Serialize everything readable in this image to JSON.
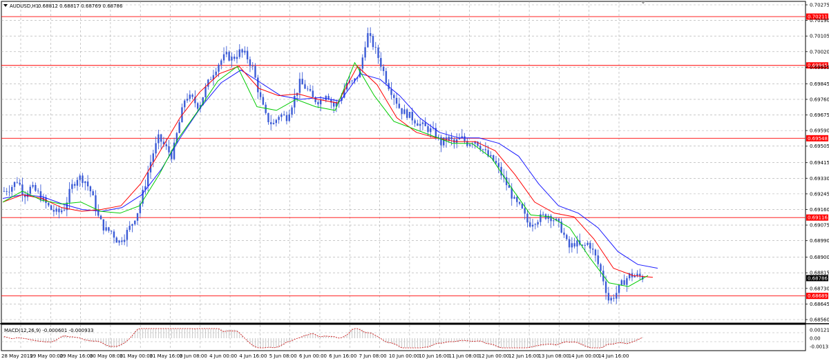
{
  "header": {
    "symbol": "AUDUSD,H1",
    "ohlc": "0.68812 0.68817 0.68769 0.68786",
    "menu_arrow": "triangle-down-icon"
  },
  "macd": {
    "label": "MACD(12,26,9) -0.000601 -0.000933",
    "ticks": [
      "0.001215",
      "0.00",
      "-0.001317"
    ]
  },
  "chart_data": {
    "type": "candlestick",
    "symbol": "AUDUSD",
    "timeframe": "H1",
    "ylim": [
      0.6856,
      0.70275
    ],
    "y_ticks": [
      "0.70275",
      "0.70190",
      "0.70105",
      "0.70020",
      "0.69935",
      "0.69845",
      "0.69760",
      "0.69675",
      "0.69590",
      "0.69505",
      "0.69415",
      "0.69330",
      "0.69245",
      "0.69160",
      "0.69075",
      "0.68990",
      "0.68900",
      "0.68815",
      "0.68730",
      "0.68645",
      "0.68560"
    ],
    "x_ticks": [
      "28 May 2019",
      "29 May 00:00",
      "29 May 16:00",
      "30 May 08:00",
      "31 May 00:00",
      "31 May 16:00",
      "3 Jun 08:00",
      "4 Jun 00:00",
      "4 Jun 16:00",
      "5 Jun 08:00",
      "6 Jun 00:00",
      "6 Jun 16:00",
      "7 Jun 08:00",
      "10 Jun 00:00",
      "10 Jun 16:00",
      "11 Jun 08:00",
      "12 Jun 00:00",
      "12 Jun 16:00",
      "13 Jun 08:00",
      "14 Jun 00:00",
      "14 Jun 16:00"
    ],
    "horizontal_levels": [
      "0.70211",
      "0.69945",
      "0.69548",
      "0.69116",
      "0.68689"
    ],
    "current_price": "0.68786",
    "grid": true,
    "colors": {
      "candles": "#3b5bd6",
      "levels": "#ff0000",
      "level_box": "#ff0000",
      "current_box": "#000000",
      "ma_fast": "#00cc00",
      "ma_mid": "#ff0000",
      "ma_slow": "#1a1aff",
      "macd": "#cc0000",
      "grid": "#a8a8a8"
    },
    "price_path": [
      [
        0.6926,
        0.6928
      ],
      [
        0.6932,
        0.6924
      ],
      [
        0.6928,
        0.6925
      ],
      [
        0.692,
        0.6916
      ],
      [
        0.6914,
        0.6917
      ],
      [
        0.6928,
        0.6934
      ],
      [
        0.6932,
        0.6925
      ],
      [
        0.6912,
        0.6905
      ],
      [
        0.6904,
        0.6898
      ],
      [
        0.6902,
        0.6908
      ],
      [
        0.6916,
        0.693
      ],
      [
        0.6945,
        0.6955
      ],
      [
        0.695,
        0.6945
      ],
      [
        0.6962,
        0.6978
      ],
      [
        0.6976,
        0.6972
      ],
      [
        0.6982,
        0.699
      ],
      [
        0.6996,
        0.7
      ],
      [
        0.6998,
        0.7002
      ],
      [
        0.7,
        0.6993
      ],
      [
        0.6978,
        0.6966
      ],
      [
        0.6962,
        0.6968
      ],
      [
        0.6966,
        0.6975
      ],
      [
        0.6985,
        0.6982
      ],
      [
        0.6976,
        0.6975
      ],
      [
        0.698,
        0.6972
      ],
      [
        0.6976,
        0.6985
      ],
      [
        0.6985,
        0.6992
      ],
      [
        0.7012,
        0.7005
      ],
      [
        0.6996,
        0.6985
      ],
      [
        0.6978,
        0.697
      ],
      [
        0.6968,
        0.6965
      ],
      [
        0.6962,
        0.696
      ],
      [
        0.6958,
        0.6952
      ],
      [
        0.6955,
        0.6952
      ],
      [
        0.6955,
        0.6952
      ],
      [
        0.6954,
        0.695
      ],
      [
        0.6945,
        0.6942
      ],
      [
        0.6935,
        0.6928
      ],
      [
        0.692,
        0.6916
      ],
      [
        0.6908,
        0.691
      ],
      [
        0.6912,
        0.6913
      ],
      [
        0.691,
        0.6905
      ],
      [
        0.6895,
        0.6898
      ],
      [
        0.6895,
        0.6898
      ],
      [
        0.689,
        0.688
      ],
      [
        0.6866,
        0.687
      ],
      [
        0.6876,
        0.688
      ],
      [
        0.688,
        0.6879
      ]
    ],
    "ma_fast_path": [
      0.692,
      0.6926,
      0.6921,
      0.6919,
      0.692,
      0.6915,
      0.6914,
      0.6918,
      0.6935,
      0.6955,
      0.697,
      0.6986,
      0.6994,
      0.6972,
      0.697,
      0.6976,
      0.6972,
      0.697,
      0.6996,
      0.6978,
      0.6964,
      0.696,
      0.6956,
      0.6952,
      0.6952,
      0.6944,
      0.6928,
      0.6913,
      0.6912,
      0.6906,
      0.689,
      0.6876,
      0.6874,
      0.688
    ],
    "ma_mid_path": [
      0.692,
      0.6924,
      0.6922,
      0.6917,
      0.6915,
      0.6916,
      0.6918,
      0.693,
      0.6948,
      0.6966,
      0.698,
      0.699,
      0.6994,
      0.6982,
      0.6978,
      0.6979,
      0.6976,
      0.6974,
      0.6994,
      0.6984,
      0.6966,
      0.6958,
      0.6955,
      0.6953,
      0.6953,
      0.6948,
      0.6935,
      0.692,
      0.6914,
      0.6912,
      0.69,
      0.6884,
      0.688,
      0.6879
    ],
    "ma_slow_path": [
      0.6922,
      0.6924,
      0.6923,
      0.6919,
      0.6916,
      0.6915,
      0.6917,
      0.6924,
      0.6938,
      0.6956,
      0.6972,
      0.6985,
      0.6992,
      0.6985,
      0.6978,
      0.6976,
      0.6977,
      0.6975,
      0.699,
      0.6987,
      0.6978,
      0.6966,
      0.6958,
      0.6955,
      0.6955,
      0.6952,
      0.6945,
      0.693,
      0.6918,
      0.6914,
      0.6906,
      0.6893,
      0.6886,
      0.6884
    ]
  }
}
